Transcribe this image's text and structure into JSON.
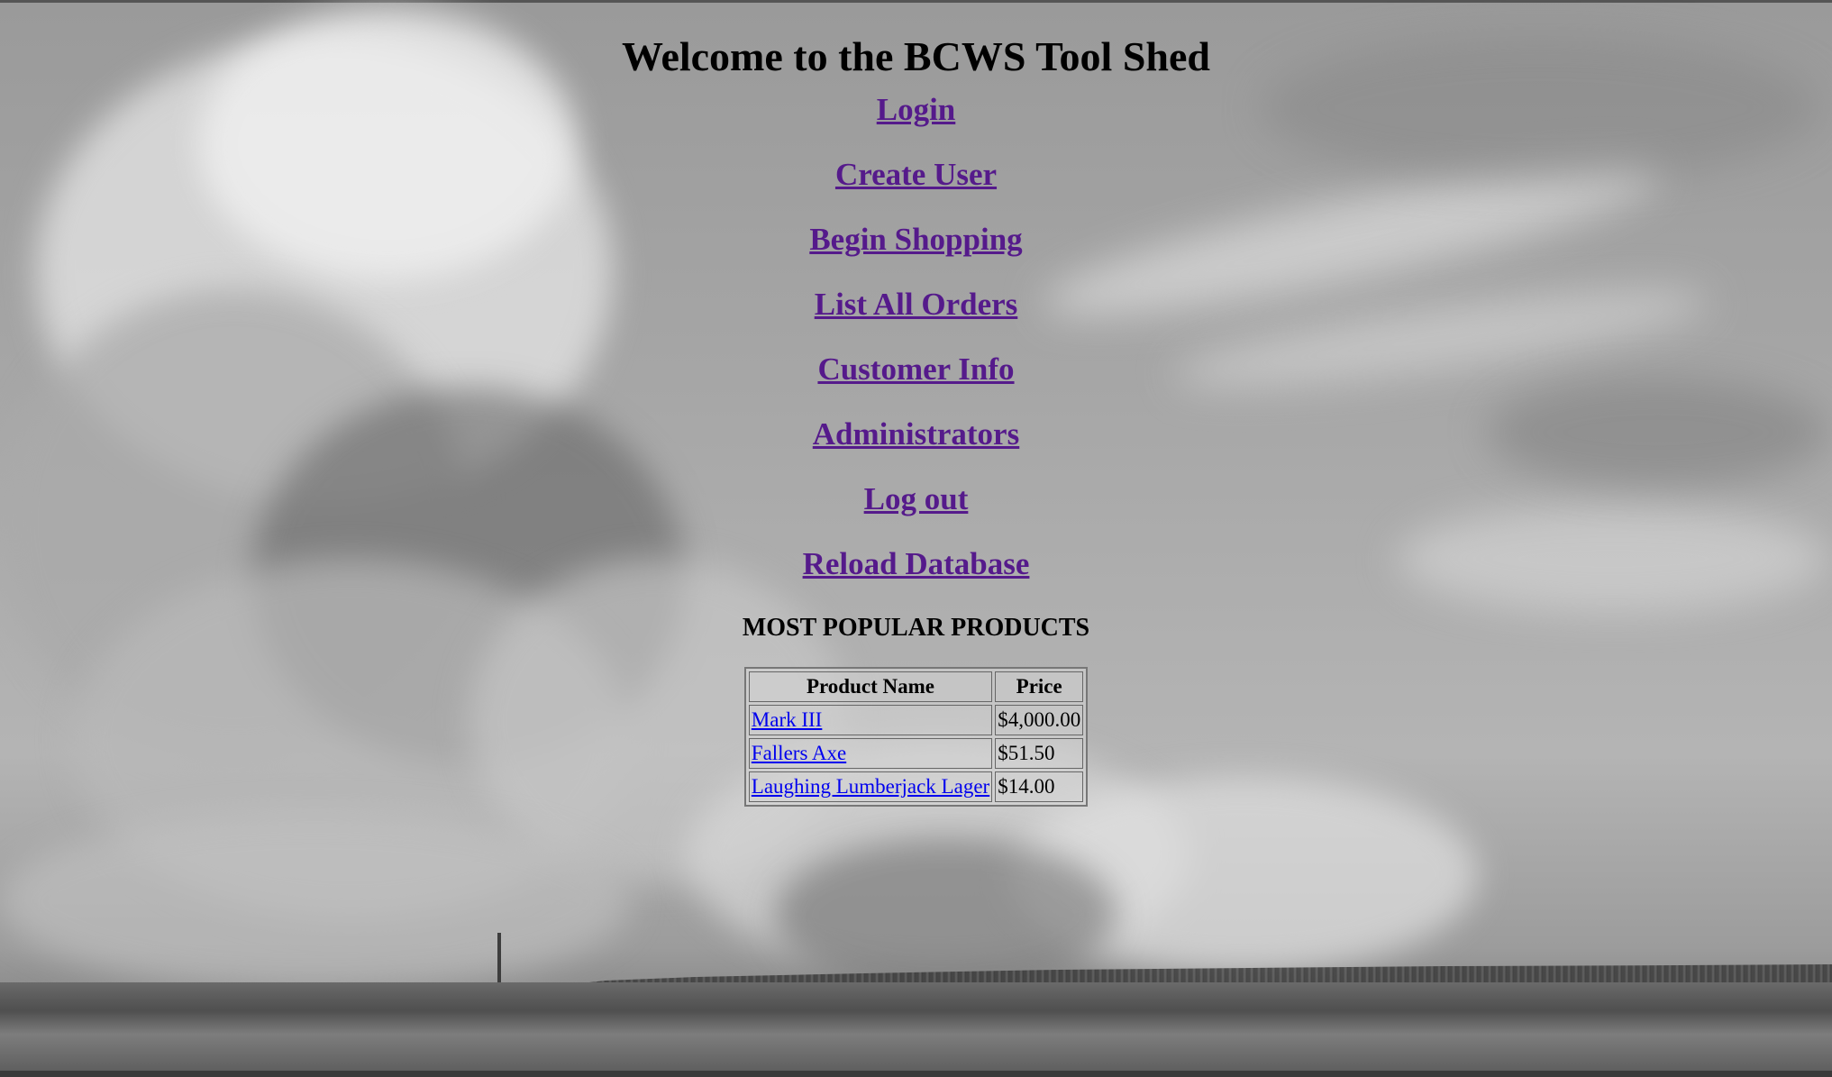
{
  "page": {
    "title": "Welcome to the BCWS Tool Shed"
  },
  "nav": {
    "items": [
      {
        "label": "Login"
      },
      {
        "label": "Create User"
      },
      {
        "label": "Begin Shopping"
      },
      {
        "label": "List All Orders"
      },
      {
        "label": "Customer Info"
      },
      {
        "label": "Administrators"
      },
      {
        "label": "Log out"
      },
      {
        "label": "Reload Database"
      }
    ]
  },
  "popular": {
    "heading": "MOST POPULAR PRODUCTS",
    "columns": [
      "Product Name",
      "Price"
    ],
    "rows": [
      {
        "name": "Mark III",
        "price": "$4,000.00"
      },
      {
        "name": "Fallers Axe",
        "price": "$51.50"
      },
      {
        "name": "Laughing Lumberjack Lager",
        "price": "$14.00"
      }
    ]
  },
  "colors": {
    "visited_link": "#551a8b",
    "link": "#0000ee"
  }
}
